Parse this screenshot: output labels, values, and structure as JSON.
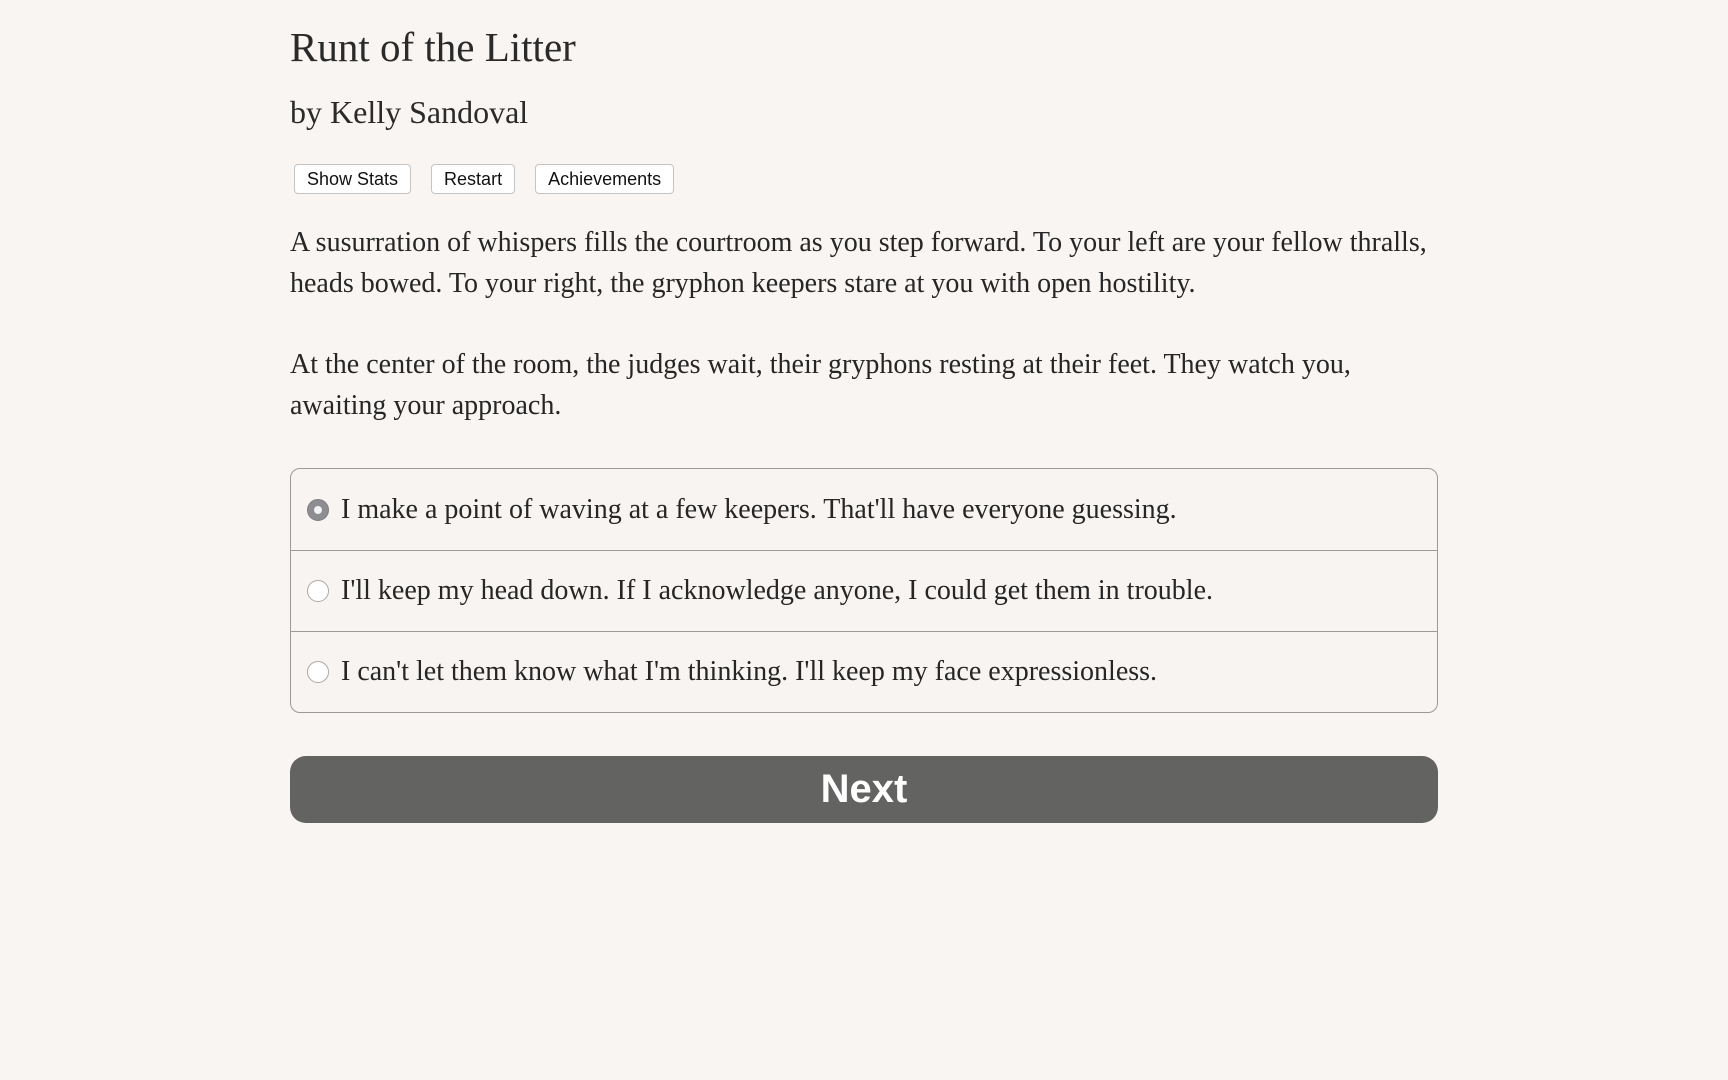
{
  "game": {
    "title": "Runt of the Litter",
    "author": "by Kelly Sandoval"
  },
  "toolbar": {
    "show_stats_label": "Show Stats",
    "restart_label": "Restart",
    "achievements_label": "Achievements"
  },
  "passage": {
    "paragraphs": [
      "A susurration of whispers fills the courtroom as you step forward. To your left are your fellow thralls, heads bowed. To your right, the gryphon keepers stare at you with open hostility.",
      "At the center of the room, the judges wait, their gryphons resting at their feet. They watch you, awaiting your approach."
    ]
  },
  "choices": {
    "selected_index": 0,
    "options": [
      "I make a point of waving at a few keepers. That'll have everyone guessing.",
      "I'll keep my head down. If I acknowledge anyone, I could get them in trouble.",
      "I can't let them know what I'm thinking. I'll keep my face expressionless."
    ]
  },
  "next": {
    "label": "Next"
  },
  "colors": {
    "background": "#f8f5f2",
    "next_button": "#636362",
    "border": "#9a9a9a"
  }
}
